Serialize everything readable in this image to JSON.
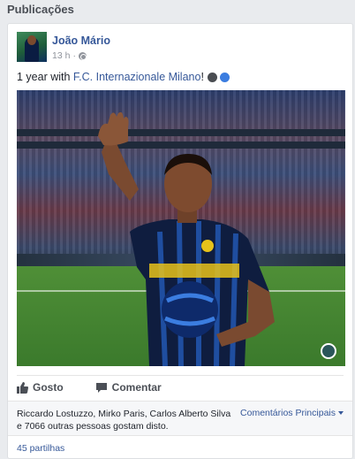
{
  "section": {
    "title": "Publicações"
  },
  "post": {
    "author": "João Mário",
    "time": "13 h",
    "separator": "·",
    "text_prefix": "1 year with ",
    "text_link": "F.C. Internazionale Milano",
    "text_suffix": "!",
    "emoji": [
      "black-circle",
      "blue-circle"
    ]
  },
  "actions": {
    "like_label": "Gosto",
    "comment_label": "Comentar"
  },
  "likes": {
    "text": "Riccardo Lostuzzo, Mirko Paris, Carlos Alberto Silva e 7066 outras pessoas gostam disto.",
    "comments_filter": "Comentários Principais"
  },
  "shares": {
    "text": "45 partilhas"
  },
  "colors": {
    "link": "#365899",
    "background": "#e9ebee",
    "card": "#ffffff",
    "muted": "#90949c"
  }
}
